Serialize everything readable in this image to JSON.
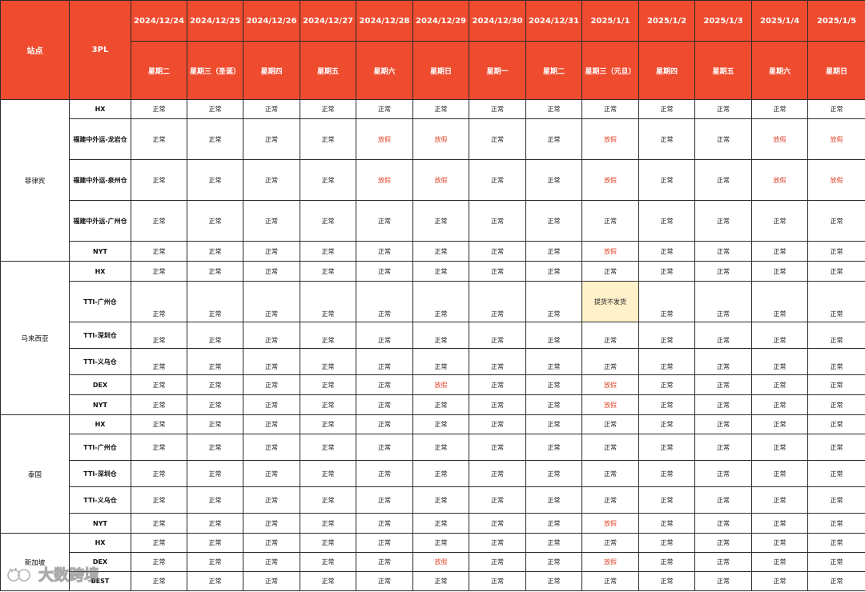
{
  "header": {
    "site_label": "站点",
    "tpl_label": "3PL",
    "dates": [
      "2024/12/24",
      "2024/12/25",
      "2024/12/26",
      "2024/12/27",
      "2024/12/28",
      "2024/12/29",
      "2024/12/30",
      "2024/12/31",
      "2025/1/1",
      "2025/1/2",
      "2025/1/3",
      "2025/1/4",
      "2025/1/5"
    ],
    "weekdays": [
      "星期二",
      "星期三（圣诞）",
      "星期四",
      "星期五",
      "星期六",
      "星期日",
      "星期一",
      "星期二",
      "星期三（元旦）",
      "星期四",
      "星期五",
      "星期六",
      "星期日"
    ]
  },
  "colors": {
    "header_bg": "#ef4b2f",
    "holiday_text": "#e3492e",
    "special_bg": "#fff1c9"
  },
  "legend": {
    "normal": "正常",
    "holiday": "放假"
  },
  "sites": [
    {
      "name": "菲律宾",
      "rows": [
        {
          "tpl": "HX",
          "h": 24,
          "cells": [
            "正常",
            "正常",
            "正常",
            "正常",
            "正常",
            "正常",
            "正常",
            "正常",
            "正常",
            "正常",
            "正常",
            "正常",
            "正常"
          ]
        },
        {
          "tpl": "福建中外运-龙岩仓",
          "h": 51,
          "cells": [
            "正常",
            "正常",
            "正常",
            "正常",
            "放假",
            "放假",
            "正常",
            "正常",
            "放假",
            "正常",
            "正常",
            "放假",
            "放假"
          ]
        },
        {
          "tpl": "福建中外运-泉州仓",
          "h": 51,
          "cells": [
            "正常",
            "正常",
            "正常",
            "正常",
            "放假",
            "放假",
            "正常",
            "正常",
            "放假",
            "正常",
            "正常",
            "放假",
            "放假"
          ]
        },
        {
          "tpl": "福建中外运-广州仓",
          "h": 51,
          "cells": [
            "正常",
            "正常",
            "正常",
            "正常",
            "正常",
            "正常",
            "正常",
            "正常",
            "正常",
            "正常",
            "正常",
            "正常",
            "正常"
          ]
        },
        {
          "tpl": "NYT",
          "h": 25,
          "cells": [
            "正常",
            "正常",
            "正常",
            "正常",
            "正常",
            "正常",
            "正常",
            "正常",
            "放假",
            "正常",
            "正常",
            "正常",
            "正常"
          ]
        }
      ]
    },
    {
      "name": "马来西亚",
      "rows": [
        {
          "tpl": "HX",
          "h": 25,
          "cells": [
            "正常",
            "正常",
            "正常",
            "正常",
            "正常",
            "正常",
            "正常",
            "正常",
            "正常",
            "正常",
            "正常",
            "正常",
            "正常"
          ]
        },
        {
          "tpl": "TTI-广州仓",
          "h": 51,
          "bottom": true,
          "cells": [
            "正常",
            "正常",
            "正常",
            "正常",
            "正常",
            "正常",
            "正常",
            "正常",
            "提货不发货",
            "正常",
            "正常",
            "正常",
            "正常"
          ]
        },
        {
          "tpl": "TTI-深圳仓",
          "h": 33,
          "bottom": true,
          "cells": [
            "正常",
            "正常",
            "正常",
            "正常",
            "正常",
            "正常",
            "正常",
            "正常",
            "正常",
            "正常",
            "正常",
            "正常",
            "正常"
          ]
        },
        {
          "tpl": "TTI-义乌仓",
          "h": 33,
          "bottom": true,
          "cells": [
            "正常",
            "正常",
            "正常",
            "正常",
            "正常",
            "正常",
            "正常",
            "正常",
            "正常",
            "正常",
            "正常",
            "正常",
            "正常"
          ]
        },
        {
          "tpl": "DEX",
          "h": 25,
          "cells": [
            "正常",
            "正常",
            "正常",
            "正常",
            "正常",
            "放假",
            "正常",
            "正常",
            "放假",
            "正常",
            "正常",
            "正常",
            "正常"
          ]
        },
        {
          "tpl": "NYT",
          "h": 25,
          "cells": [
            "正常",
            "正常",
            "正常",
            "正常",
            "正常",
            "正常",
            "正常",
            "正常",
            "放假",
            "正常",
            "正常",
            "正常",
            "正常"
          ]
        }
      ]
    },
    {
      "name": "泰国",
      "rows": [
        {
          "tpl": "HX",
          "h": 24,
          "cells": [
            "正常",
            "正常",
            "正常",
            "正常",
            "正常",
            "正常",
            "正常",
            "正常",
            "正常",
            "正常",
            "正常",
            "正常",
            "正常"
          ]
        },
        {
          "tpl": "TTI-广州仓",
          "h": 33,
          "cells": [
            "正常",
            "正常",
            "正常",
            "正常",
            "正常",
            "正常",
            "正常",
            "正常",
            "正常",
            "正常",
            "正常",
            "正常",
            "正常"
          ]
        },
        {
          "tpl": "TTI-深圳仓",
          "h": 33,
          "cells": [
            "正常",
            "正常",
            "正常",
            "正常",
            "正常",
            "正常",
            "正常",
            "正常",
            "正常",
            "正常",
            "正常",
            "正常",
            "正常"
          ]
        },
        {
          "tpl": "TTI-义乌仓",
          "h": 33,
          "cells": [
            "正常",
            "正常",
            "正常",
            "正常",
            "正常",
            "正常",
            "正常",
            "正常",
            "正常",
            "正常",
            "正常",
            "正常",
            "正常"
          ]
        },
        {
          "tpl": "NYT",
          "h": 25,
          "cells": [
            "正常",
            "正常",
            "正常",
            "正常",
            "正常",
            "正常",
            "正常",
            "正常",
            "放假",
            "正常",
            "正常",
            "正常",
            "正常"
          ]
        }
      ]
    },
    {
      "name": "新加坡",
      "rows": [
        {
          "tpl": "HX",
          "h": 24,
          "cells": [
            "正常",
            "正常",
            "正常",
            "正常",
            "正常",
            "正常",
            "正常",
            "正常",
            "正常",
            "正常",
            "正常",
            "正常",
            "正常"
          ]
        },
        {
          "tpl": "DEX",
          "h": 24,
          "cells": [
            "正常",
            "正常",
            "正常",
            "正常",
            "正常",
            "放假",
            "正常",
            "正常",
            "放假",
            "正常",
            "正常",
            "正常",
            "正常"
          ]
        },
        {
          "tpl": "BEST",
          "h": 24,
          "cells": [
            "正常",
            "正常",
            "正常",
            "正常",
            "正常",
            "正常",
            "正常",
            "正常",
            "正常",
            "正常",
            "正常",
            "正常",
            "正常"
          ]
        }
      ]
    }
  ],
  "watermark": {
    "text": "大数跨境"
  }
}
